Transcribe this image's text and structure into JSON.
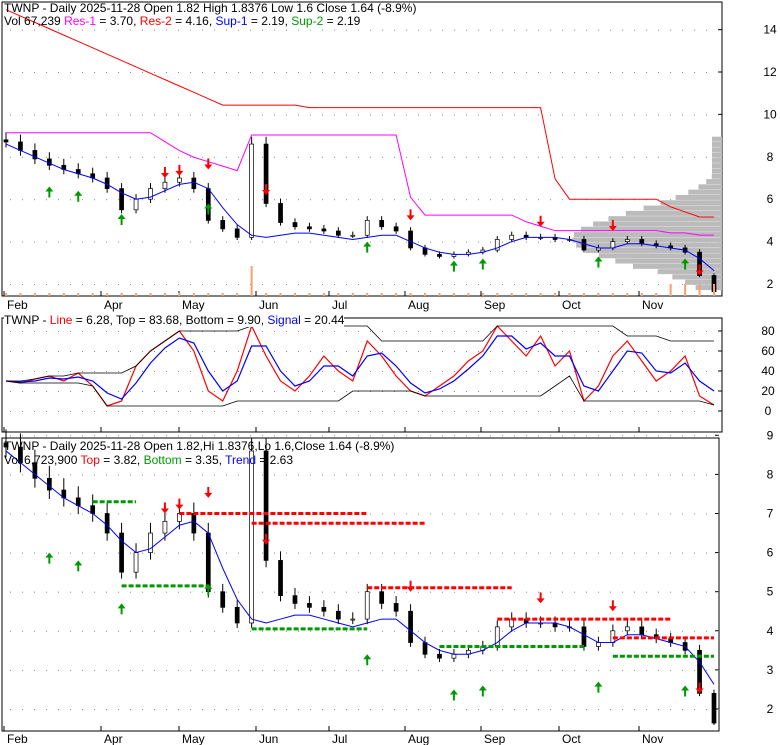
{
  "panel1": {
    "title": "TWNP - Daily 2025-11-28 Open 1.82  High 1.8376  Low 1.6  Close 1.64 (-8.9%)",
    "vol": "Vol 67,239",
    "res1_label": "Res-1",
    "res1_val": " = 3.70, ",
    "res2_label": "Res-2",
    "res2_val": " = 4.16, ",
    "sup1_label": "Sup-1",
    "sup1_val": " = 2.19, ",
    "sup2_label": "Sup-2",
    "sup2_val": " = 2.19"
  },
  "panel2": {
    "ticker": "TWNP - ",
    "line_label": "Line",
    "line_val": " = 6.28, Top = 83.68, Bottom = 9.90, ",
    "signal_label": "Signal",
    "signal_val": " = 20.44"
  },
  "panel3": {
    "title": "TWNP - Daily 2025-11-28 Open 1.82,Hi 1.8376,Lo 1.6,Close 1.64 (-8.9%)",
    "vol": "Vol 6,723,900",
    "top_label": "Top",
    "top_val": " = 3.82, ",
    "bottom_label": "Bottom",
    "bottom_val": " = 3.35, ",
    "trend_label": "Trend",
    "trend_val": " = 2.63"
  },
  "colors": {
    "res1": "#ff00ff",
    "res2": "#ff0000",
    "sup1": "#0000ff",
    "sup2": "#009900",
    "up": "#009900",
    "down": "#ff0000"
  },
  "chart_data": [
    {
      "type": "line",
      "title": "TWNP price with support/resistance",
      "x_labels": [
        "Feb",
        "Apr",
        "May",
        "Jun",
        "Jul",
        "Aug",
        "Sep",
        "Oct",
        "Nov"
      ],
      "y_ticks": [
        2,
        4,
        6,
        8,
        10,
        12,
        14
      ],
      "ylim": [
        1.5,
        15
      ],
      "closes": [
        8.7,
        8.3,
        7.9,
        7.6,
        7.4,
        7.2,
        7.0,
        6.5,
        5.5,
        6.0,
        6.5,
        6.8,
        7.0,
        6.5,
        5.0,
        4.6,
        4.2,
        8.6,
        5.8,
        4.9,
        4.7,
        4.6,
        4.5,
        4.3,
        4.3,
        5.0,
        4.7,
        4.5,
        3.7,
        3.4,
        3.3,
        3.4,
        3.5,
        3.6,
        4.1,
        4.3,
        4.2,
        4.2,
        4.1,
        4.1,
        3.6,
        3.7,
        4.0,
        4.1,
        3.9,
        3.8,
        3.7,
        3.5,
        2.4,
        1.64
      ]
    },
    {
      "type": "line",
      "title": "Stochastic",
      "y_ticks": [
        0,
        20,
        40,
        60,
        80
      ],
      "ylim": [
        -5,
        90
      ],
      "series": [
        {
          "name": "Line",
          "values": [
            30,
            28,
            32,
            35,
            30,
            38,
            25,
            5,
            10,
            45,
            60,
            70,
            80,
            60,
            20,
            10,
            40,
            85,
            55,
            30,
            20,
            35,
            55,
            40,
            30,
            70,
            55,
            35,
            20,
            15,
            25,
            35,
            50,
            60,
            85,
            70,
            55,
            75,
            45,
            60,
            10,
            25,
            55,
            70,
            50,
            30,
            40,
            55,
            15,
            6
          ]
        },
        {
          "name": "Signal",
          "values": [
            30,
            29,
            30,
            33,
            32,
            34,
            30,
            18,
            12,
            28,
            48,
            63,
            73,
            68,
            40,
            20,
            30,
            65,
            65,
            40,
            25,
            30,
            45,
            45,
            35,
            55,
            58,
            45,
            28,
            18,
            22,
            30,
            42,
            55,
            75,
            75,
            62,
            68,
            55,
            55,
            25,
            20,
            40,
            60,
            58,
            40,
            38,
            48,
            30,
            20
          ]
        }
      ]
    },
    {
      "type": "line",
      "title": "TWNP daily candles with trend",
      "y_ticks": [
        2,
        3,
        4,
        5,
        6,
        7,
        8,
        9
      ],
      "ylim": [
        1.45,
        9.7
      ],
      "trend": [
        8.6,
        8.3,
        8.0,
        7.7,
        7.4,
        7.2,
        7.0,
        6.7,
        6.3,
        6.0,
        6.1,
        6.4,
        6.7,
        6.8,
        6.5,
        5.6,
        4.8,
        4.3,
        4.2,
        4.3,
        4.4,
        4.4,
        4.3,
        4.2,
        4.1,
        4.2,
        4.3,
        4.3,
        4.0,
        3.7,
        3.5,
        3.4,
        3.4,
        3.5,
        3.7,
        4.0,
        4.2,
        4.2,
        4.2,
        4.1,
        3.9,
        3.7,
        3.7,
        3.9,
        3.9,
        3.8,
        3.7,
        3.6,
        3.2,
        2.63
      ],
      "top_lines": [
        7.0,
        6.75,
        5.1,
        4.3,
        3.82
      ],
      "bottom_lines": [
        7.3,
        5.15,
        4.05,
        3.6,
        3.35
      ]
    }
  ]
}
